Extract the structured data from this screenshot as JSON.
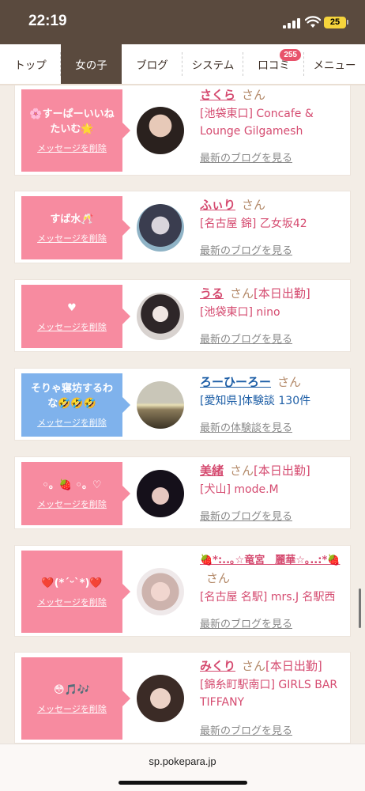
{
  "status_bar": {
    "time": "22:19",
    "battery": "25"
  },
  "nav": {
    "tabs": [
      {
        "label": "トップ",
        "active": false
      },
      {
        "label": "女の子",
        "active": true
      },
      {
        "label": "ブログ",
        "active": false
      },
      {
        "label": "システム",
        "active": false
      },
      {
        "label": "口コミ",
        "active": false,
        "badge": "255"
      },
      {
        "label": "メニュー",
        "active": false
      }
    ]
  },
  "cards": [
    {
      "message": "🌸すーぱーいいねたいむ🌟",
      "delete_label": "メッセージを削除",
      "name": "さくら",
      "honorific": "さん",
      "shift": "",
      "shop": "[池袋東口] Concafe & Lounge Gilgamesh",
      "link": "最新のブログを見る",
      "bubble_color": "pink"
    },
    {
      "message": "すば水🥂",
      "delete_label": "メッセージを削除",
      "name": "ふぃり",
      "honorific": "さん",
      "shift": "",
      "shop": "[名古屋 錦] 乙女坂42",
      "link": "最新のブログを見る",
      "bubble_color": "pink"
    },
    {
      "message": "♥",
      "delete_label": "メッセージを削除",
      "name": "うる",
      "honorific": "さん",
      "shift": "[本日出勤]",
      "shop": "[池袋東口] nino",
      "link": "最新のブログを見る",
      "bubble_color": "pink"
    },
    {
      "message": "そりゃ寝坊するわな🤣🤣🤣",
      "delete_label": "メッセージを削除",
      "name": "ろーひーろー",
      "honorific": "さん",
      "shift": "",
      "shop": "[愛知県]体験談 130件",
      "link": "最新の体験談を見る",
      "bubble_color": "blue"
    },
    {
      "message": "◦。🍓 ◦。♡",
      "delete_label": "メッセージを削除",
      "name": "美緒",
      "honorific": "さん",
      "shift": "[本日出勤]",
      "shop": "[犬山] mode.M",
      "link": "最新のブログを見る",
      "bubble_color": "pink"
    },
    {
      "message": "❤️(*ˊᵕˋ*)❤️",
      "delete_label": "メッセージを削除",
      "name": "🍓*:..｡☆竜宮　麗華☆｡..:*🍓",
      "honorific": "さん",
      "shift": "",
      "shop": "[名古屋 名駅] mrs.J 名駅西",
      "link": "最新のブログを見る",
      "bubble_color": "pink"
    },
    {
      "message": "😳🎵🎶",
      "delete_label": "メッセージを削除",
      "name": "みくり",
      "honorific": "さん",
      "shift": "[本日出勤]",
      "shop": "[錦糸町駅南口] GIRLS BAR TIFFANY",
      "link": "最新のブログを見る",
      "bubble_color": "pink"
    }
  ],
  "url_bar": {
    "url": "sp.pokepara.jp"
  },
  "colors": {
    "header": "#5a4a3e",
    "accent_pink": "#f78ba0",
    "accent_blue": "#7fb2ec",
    "name_pink": "#d54b70",
    "name_blue": "#1d5ea6"
  }
}
